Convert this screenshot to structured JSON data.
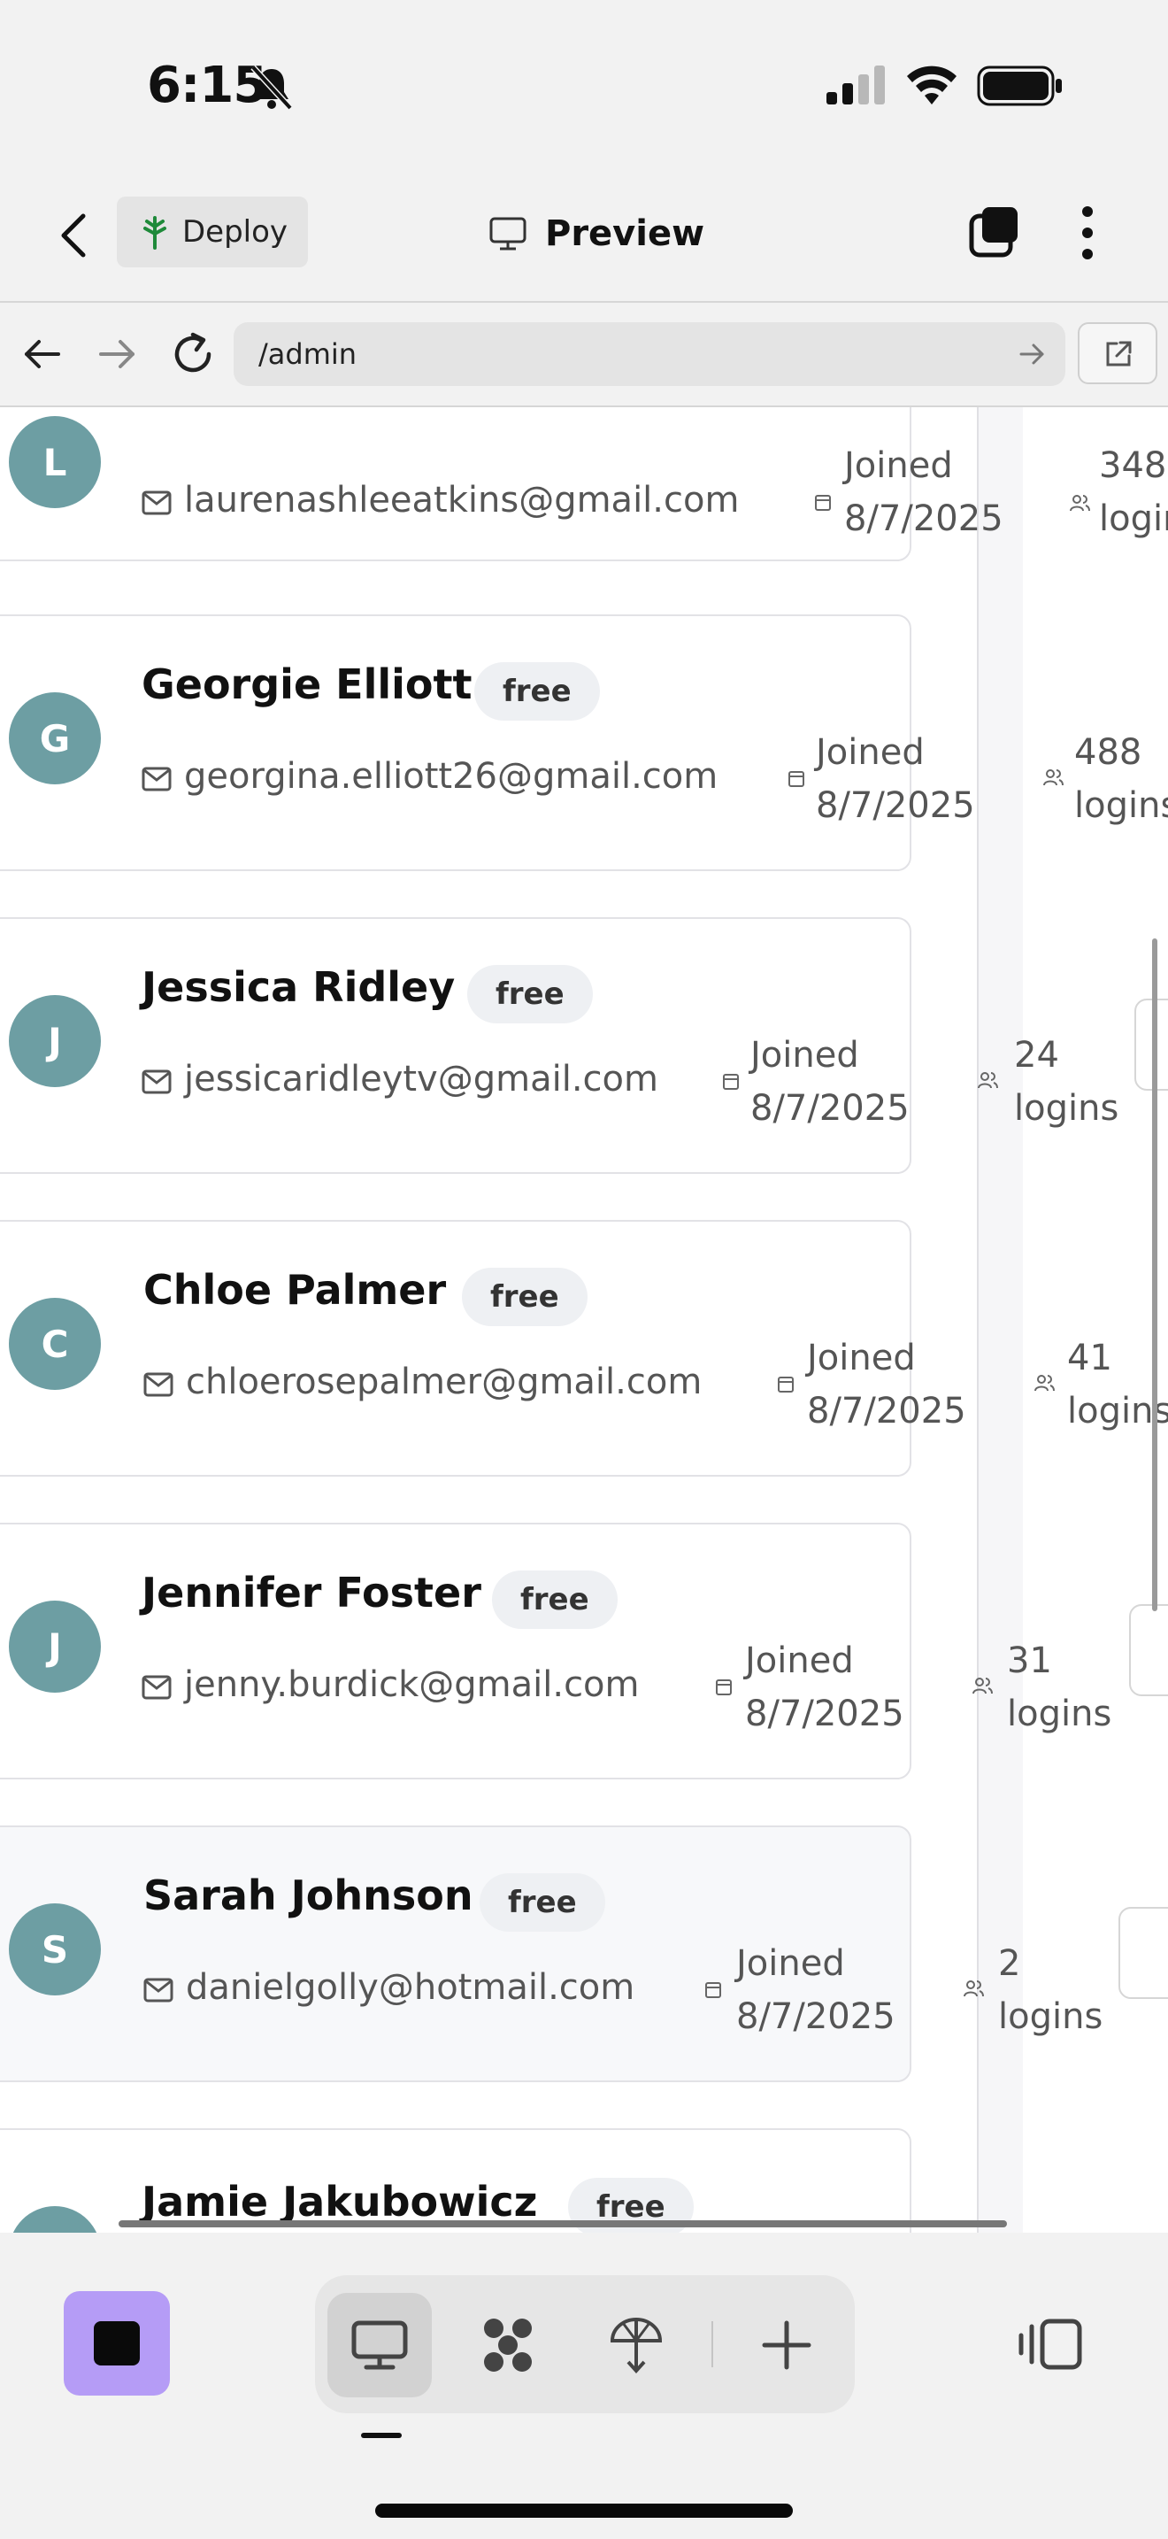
{
  "status_bar": {
    "time": "6:15"
  },
  "header": {
    "deploy_label": "Deploy",
    "title": "Preview"
  },
  "browser": {
    "url": "/admin"
  },
  "colors": {
    "avatar": "#6d9ea3",
    "project_button": "#b59cf6",
    "badge_bg": "#eef0f3"
  },
  "users": [
    {
      "initial": "L",
      "name": "",
      "plan": "",
      "email": "laurenashleeatkins@gmail.com",
      "joined_label": "Joined",
      "joined_date": "8/7/2025",
      "logins_count": "348",
      "logins_label": "logins"
    },
    {
      "initial": "G",
      "name": "Georgie Elliott",
      "plan": "free",
      "email": "georgina.elliott26@gmail.com",
      "joined_label": "Joined",
      "joined_date": "8/7/2025",
      "logins_count": "488",
      "logins_label": "logins"
    },
    {
      "initial": "J",
      "name": "Jessica Ridley",
      "plan": "free",
      "email": "jessicaridleytv@gmail.com",
      "joined_label": "Joined",
      "joined_date": "8/7/2025",
      "logins_count": "24",
      "logins_label": "logins"
    },
    {
      "initial": "C",
      "name": "Chloe Palmer",
      "plan": "free",
      "email": "chloerosepalmer@gmail.com",
      "joined_label": "Joined",
      "joined_date": "8/7/2025",
      "logins_count": "41",
      "logins_label": "logins"
    },
    {
      "initial": "J",
      "name": "Jennifer Foster",
      "plan": "free",
      "email": "jenny.burdick@gmail.com",
      "joined_label": "Joined",
      "joined_date": "8/7/2025",
      "logins_count": "31",
      "logins_label": "logins"
    },
    {
      "initial": "S",
      "name": "Sarah Johnson",
      "plan": "free",
      "email": "danielgolly@hotmail.com",
      "joined_label": "Joined",
      "joined_date": "8/7/2025",
      "logins_count": "2",
      "logins_label": "logins"
    },
    {
      "initial": "",
      "name": "Jamie Jakubowicz",
      "plan": "free",
      "email": "",
      "joined_label": "",
      "joined_date": "",
      "logins_count": "",
      "logins_label": ""
    }
  ],
  "bottom_toolbar": {
    "icons": [
      "desktop-icon",
      "apps-icon",
      "deploy-icon",
      "plus-icon",
      "panel-icon"
    ]
  }
}
